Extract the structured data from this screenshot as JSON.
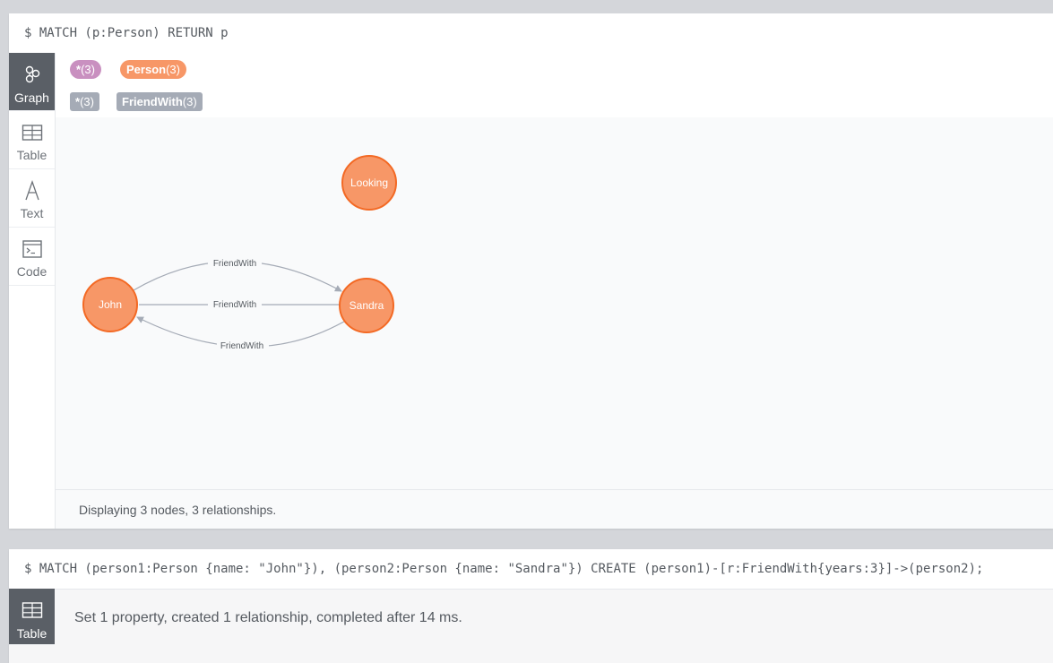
{
  "frame1": {
    "command": "$ MATCH (p:Person) RETURN p",
    "sidebar": [
      {
        "label": "Graph",
        "icon": "graph-icon",
        "active": true
      },
      {
        "label": "Table",
        "icon": "table-icon",
        "active": false
      },
      {
        "label": "Text",
        "icon": "text-icon",
        "active": false
      },
      {
        "label": "Code",
        "icon": "code-icon",
        "active": false
      }
    ],
    "node_labels": [
      {
        "name": "*",
        "count": "(3)",
        "color": "#c990c0"
      },
      {
        "name": "Person",
        "count": "(3)",
        "color": "#f79767"
      }
    ],
    "relationship_types": [
      {
        "name": "*",
        "count": "(3)",
        "color": "#a5abb6"
      },
      {
        "name": "FriendWith",
        "count": "(3)",
        "color": "#a5abb6"
      }
    ],
    "graph": {
      "nodes": [
        {
          "id": "john",
          "caption": "John"
        },
        {
          "id": "sandra",
          "caption": "Sandra"
        },
        {
          "id": "looking",
          "caption": "Looking"
        }
      ],
      "relationships": [
        {
          "from": "john",
          "to": "sandra",
          "type": "FriendWith"
        },
        {
          "from": "john",
          "to": "sandra",
          "type": "FriendWith"
        },
        {
          "from": "sandra",
          "to": "john",
          "type": "FriendWith"
        }
      ],
      "node_color": "#f79767",
      "node_border": "#f36924",
      "edge_color": "#a5abb6"
    },
    "status": "Displaying 3 nodes, 3 relationships."
  },
  "frame2": {
    "command": "$ MATCH (person1:Person {name: \"John\"}), (person2:Person {name: \"Sandra\"}) CREATE (person1)-[r:FriendWith{years:3}]->(person2);",
    "sidebar": [
      {
        "label": "Table",
        "icon": "table-icon",
        "active": true
      }
    ],
    "result": "Set 1 property, created 1 relationship, completed after 14 ms."
  }
}
